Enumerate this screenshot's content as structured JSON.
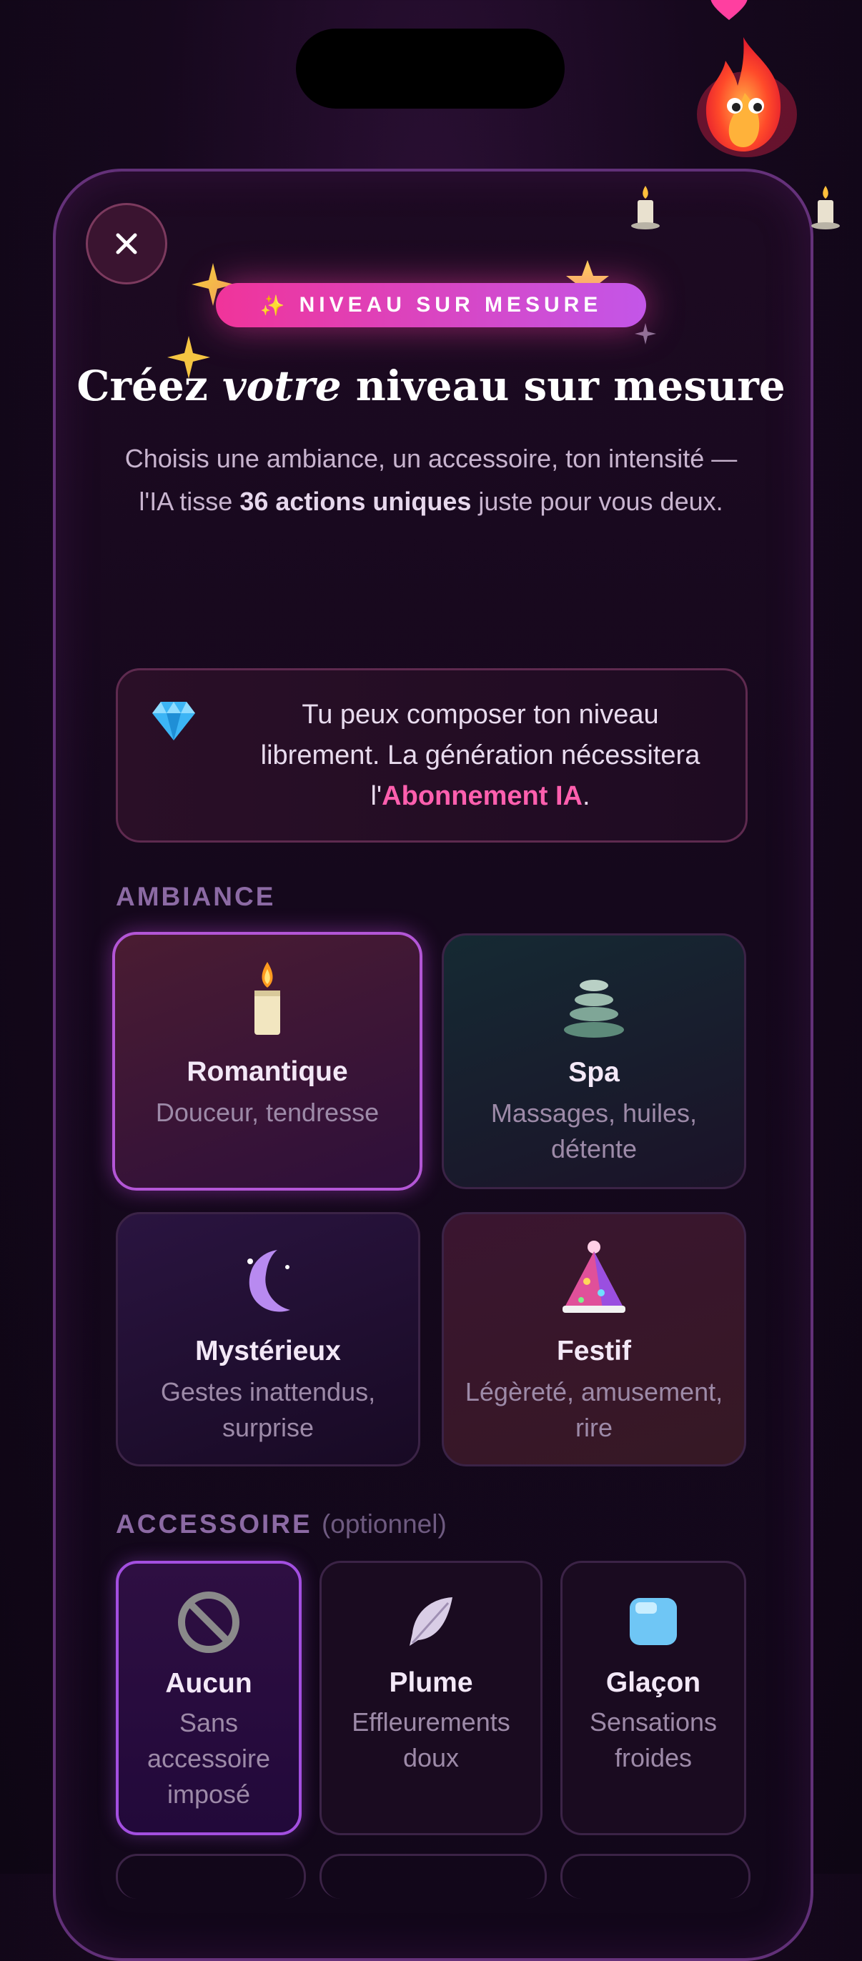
{
  "badge": {
    "label": "NIVEAU SUR MESURE",
    "spark": "✨"
  },
  "header": {
    "title_part1": "Créez ",
    "title_italic": "votre",
    "title_part2": " niveau sur mesure",
    "subtitle_part1": "Choisis une ambiance, un accessoire, ton intensité — l'IA tisse ",
    "subtitle_bold": "36 actions uniques",
    "subtitle_part2": " juste pour vous deux."
  },
  "notice": {
    "text_part1": "Tu peux composer ton niveau librement. La génération nécessitera l'",
    "link": "Abonnement IA",
    "text_part2": "."
  },
  "ambiance": {
    "label": "AMBIANCE",
    "items": [
      {
        "title": "Romantique",
        "desc": "Douceur, tendresse",
        "icon": "candle-icon",
        "selected": true
      },
      {
        "title": "Spa",
        "desc": "Massages, huiles, détente",
        "icon": "stones-icon",
        "selected": false
      },
      {
        "title": "Mystérieux",
        "desc": "Gestes inattendus, surprise",
        "icon": "moon-icon",
        "selected": false
      },
      {
        "title": "Festif",
        "desc": "Légèreté, amusement, rire",
        "icon": "party-hat-icon",
        "selected": false
      }
    ]
  },
  "accessoire": {
    "label": "ACCESSOIRE",
    "optional": "(optionnel)",
    "items": [
      {
        "title": "Aucun",
        "desc": "Sans accessoire imposé",
        "icon": "no-entry-icon",
        "selected": true
      },
      {
        "title": "Plume",
        "desc": "Effleurements doux",
        "icon": "feather-icon",
        "selected": false
      },
      {
        "title": "Glaçon",
        "desc": "Sensations froides",
        "icon": "ice-cube-icon",
        "selected": false
      }
    ]
  },
  "colors": {
    "accent_pink": "#ff5fae",
    "selected_border": "#b356d6"
  }
}
